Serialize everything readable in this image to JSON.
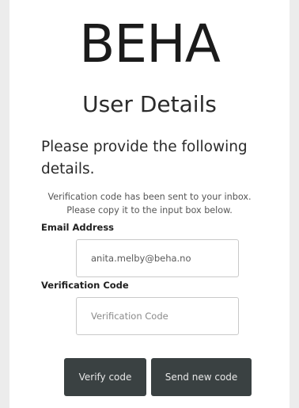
{
  "brand": {
    "logo_text": "BEHA"
  },
  "page": {
    "title": "User Details"
  },
  "prompt": "Please provide the following details.",
  "notice": {
    "line1": "Verification code has been sent to your inbox.",
    "line2": "Please copy it to the input box below."
  },
  "form": {
    "email_label": "Email Address",
    "email_value": "anita.melby@beha.no",
    "code_label": "Verification Code",
    "code_placeholder": "Verification Code",
    "code_value": ""
  },
  "actions": {
    "verify_label": "Verify code",
    "resend_label": "Send new code"
  },
  "colors": {
    "button_bg": "#3a4142",
    "button_text": "#e8e8e8",
    "page_bg": "#ececec",
    "panel_bg": "#ffffff"
  }
}
